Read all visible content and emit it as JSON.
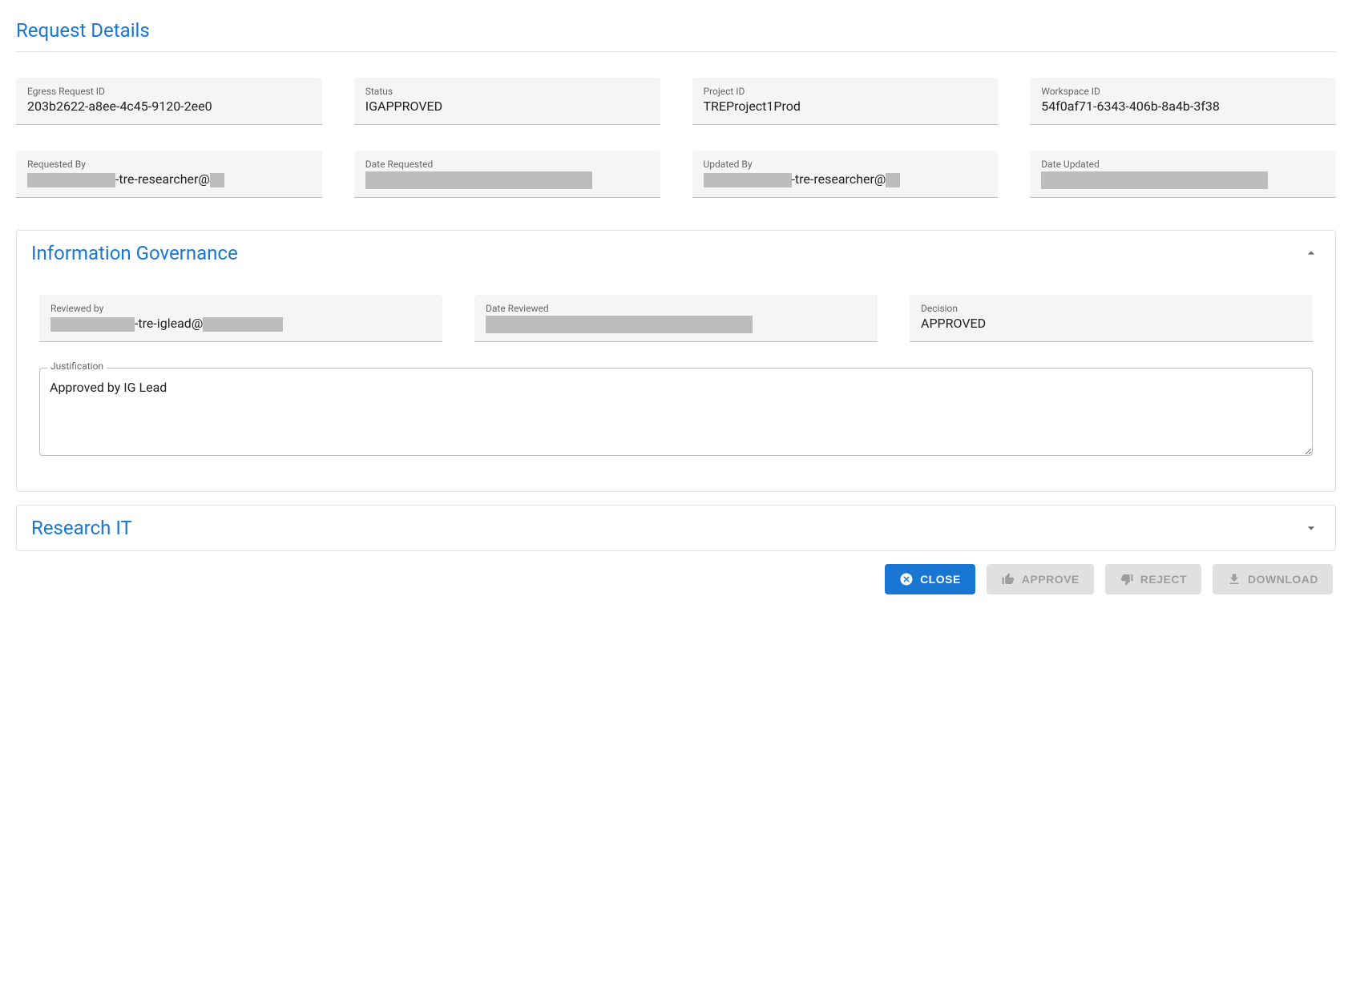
{
  "details": {
    "title": "Request Details",
    "fields": {
      "egress_id": {
        "label": "Egress Request ID",
        "value": "203b2622-a8ee-4c45-9120-2ee0"
      },
      "status": {
        "label": "Status",
        "value": "IGAPPROVED"
      },
      "project_id": {
        "label": "Project ID",
        "value": "TREProject1Prod"
      },
      "workspace_id": {
        "label": "Workspace ID",
        "value": "54f0af71-6343-406b-8a4b-3f38"
      },
      "requested_by": {
        "label": "Requested By",
        "suffix": "-tre-researcher@"
      },
      "date_requested": {
        "label": "Date Requested"
      },
      "updated_by": {
        "label": "Updated By",
        "suffix": "-tre-researcher@"
      },
      "date_updated": {
        "label": "Date Updated"
      }
    }
  },
  "ig": {
    "title": "Information Governance",
    "reviewed_by": {
      "label": "Reviewed by",
      "suffix": "-tre-iglead@"
    },
    "date_reviewed": {
      "label": "Date Reviewed"
    },
    "decision": {
      "label": "Decision",
      "value": "APPROVED"
    },
    "justification": {
      "label": "Justification",
      "value": "Approved by IG Lead"
    }
  },
  "rit": {
    "title": "Research IT"
  },
  "actions": {
    "close": "Close",
    "approve": "Approve",
    "reject": "Reject",
    "download": "Download"
  }
}
